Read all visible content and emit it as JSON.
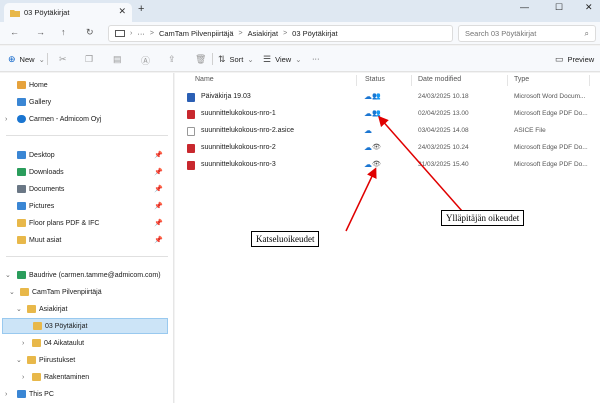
{
  "window": {
    "tab_title": "03 Pöytäkirjat",
    "tab_close": "✕",
    "new_tab": "+",
    "minimize": "—",
    "maximize": "☐",
    "close": "✕"
  },
  "addressbar": {
    "back": "←",
    "forward": "→",
    "up": "↑",
    "refresh": "↻",
    "more": "···",
    "breadcrumbs": [
      "CamTam Pilvenpiirtäjä",
      "Asiakirjat",
      "03 Pöytäkirjat"
    ],
    "breadcrumb_sep": ">",
    "search_placeholder": "Search 03 Pöytäkirjat"
  },
  "toolbar": {
    "new_label": "New",
    "sort_label": "Sort",
    "view_label": "View",
    "more_label": "···",
    "preview_label": "Preview"
  },
  "sidebar": {
    "items": [
      {
        "label": "Home",
        "icon": "home-icon",
        "color": "#e6a23c"
      },
      {
        "label": "Gallery",
        "icon": "gallery-icon",
        "color": "#3a86d4"
      },
      {
        "label": "Carmen - Admicom Oyj",
        "icon": "cloud-icon",
        "color": "#1a75d1"
      },
      {
        "label": "Desktop",
        "icon": "desktop-icon",
        "color": "#3a86d4"
      },
      {
        "label": "Downloads",
        "icon": "downloads-icon",
        "color": "#2a9d5c"
      },
      {
        "label": "Documents",
        "icon": "documents-icon",
        "color": "#6a7785"
      },
      {
        "label": "Pictures",
        "icon": "pictures-icon",
        "color": "#3a86d4"
      },
      {
        "label": "Floor plans PDF & IFC",
        "icon": "folder-icon",
        "color": "#e8b84a"
      },
      {
        "label": "Muut asiat",
        "icon": "folder-icon",
        "color": "#e8b84a"
      },
      {
        "label": "Baudrive (carmen.tamme@admicom.com)",
        "icon": "drive-icon",
        "color": "#2a9d5c"
      },
      {
        "label": "CamTam Pilvenpiirtäjä",
        "icon": "folder-icon",
        "color": "#e8b84a"
      },
      {
        "label": "Asiakirjat",
        "icon": "folder-icon",
        "color": "#e8b84a"
      },
      {
        "label": "03 Pöytäkirjat",
        "icon": "folder-icon",
        "color": "#e8b84a"
      },
      {
        "label": "04 Aikataulut",
        "icon": "folder-icon",
        "color": "#e8b84a"
      },
      {
        "label": "Piirustukset",
        "icon": "folder-icon",
        "color": "#e8b84a"
      },
      {
        "label": "Rakentaminen",
        "icon": "folder-icon",
        "color": "#e8b84a"
      },
      {
        "label": "This PC",
        "icon": "pc-icon",
        "color": "#3a86d4"
      }
    ]
  },
  "columns": {
    "name": "Name",
    "status": "Status",
    "date": "Date modified",
    "type": "Type"
  },
  "files": [
    {
      "name": "Päiväkirja 19.03",
      "date": "24/03/2025 10.18",
      "type": "Microsoft Word Docum...",
      "icon_color": "#2b5fb4",
      "status_extra": "👥"
    },
    {
      "name": "suunnittelukokous-nro-1",
      "date": "02/04/2025 13.00",
      "type": "Microsoft Edge PDF Do...",
      "icon_color": "#c8282e",
      "status_extra": "👥"
    },
    {
      "name": "suunnittelukokous-nro-2.asice",
      "date": "03/04/2025 14.08",
      "type": "ASICE File",
      "icon_color": "#ffffff",
      "status_extra": ""
    },
    {
      "name": "suunnittelukokous-nro-2",
      "date": "24/03/2025 10.24",
      "type": "Microsoft Edge PDF Do...",
      "icon_color": "#c8282e",
      "status_extra": "👁"
    },
    {
      "name": "suunnittelukokous-nro-3",
      "date": "31/03/2025 15.40",
      "type": "Microsoft Edge PDF Do...",
      "icon_color": "#c8282e",
      "status_extra": "👁"
    }
  ],
  "annotations": {
    "view_rights": "Katseluoikeudet",
    "admin_rights": "Ylläpitäjän oikeudet",
    "arrow_color": "#e00000"
  }
}
